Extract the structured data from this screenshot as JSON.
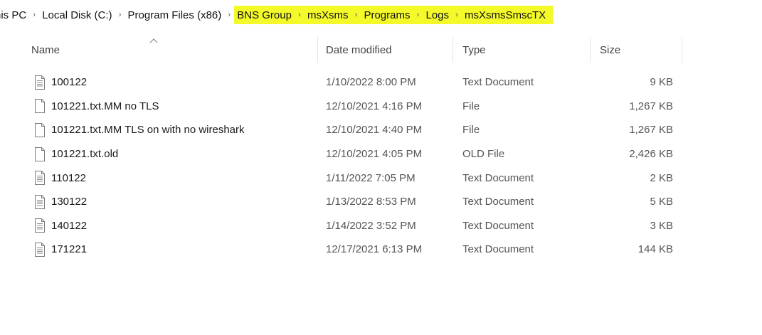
{
  "breadcrumb": {
    "plain": [
      "his PC",
      "Local Disk (C:)",
      "Program Files (x86)"
    ],
    "highlighted": [
      "BNS Group",
      "msXsms",
      "Programs",
      "Logs",
      "msXsmsSmscTX"
    ],
    "highlight_color": "#f4f92a",
    "separator_icon": "chevron-right-icon"
  },
  "columns": {
    "name": "Name",
    "date": "Date modified",
    "type": "Type",
    "size": "Size"
  },
  "files": [
    {
      "name": "100122",
      "date": "1/10/2022 8:00 PM",
      "type": "Text Document",
      "size": "9 KB",
      "icon": "text-document-icon"
    },
    {
      "name": "101221.txt.MM no TLS",
      "date": "12/10/2021 4:16 PM",
      "type": "File",
      "size": "1,267 KB",
      "icon": "blank-file-icon"
    },
    {
      "name": "101221.txt.MM TLS on with no wireshark",
      "date": "12/10/2021 4:40 PM",
      "type": "File",
      "size": "1,267 KB",
      "icon": "blank-file-icon"
    },
    {
      "name": "101221.txt.old",
      "date": "12/10/2021 4:05 PM",
      "type": "OLD File",
      "size": "2,426 KB",
      "icon": "blank-file-icon"
    },
    {
      "name": "110122",
      "date": "1/11/2022 7:05 PM",
      "type": "Text Document",
      "size": "2 KB",
      "icon": "text-document-icon"
    },
    {
      "name": "130122",
      "date": "1/13/2022 8:53 PM",
      "type": "Text Document",
      "size": "5 KB",
      "icon": "text-document-icon"
    },
    {
      "name": "140122",
      "date": "1/14/2022 3:52 PM",
      "type": "Text Document",
      "size": "3 KB",
      "icon": "text-document-icon"
    },
    {
      "name": "171221",
      "date": "12/17/2021 6:13 PM",
      "type": "Text Document",
      "size": "144 KB",
      "icon": "text-document-icon"
    }
  ]
}
